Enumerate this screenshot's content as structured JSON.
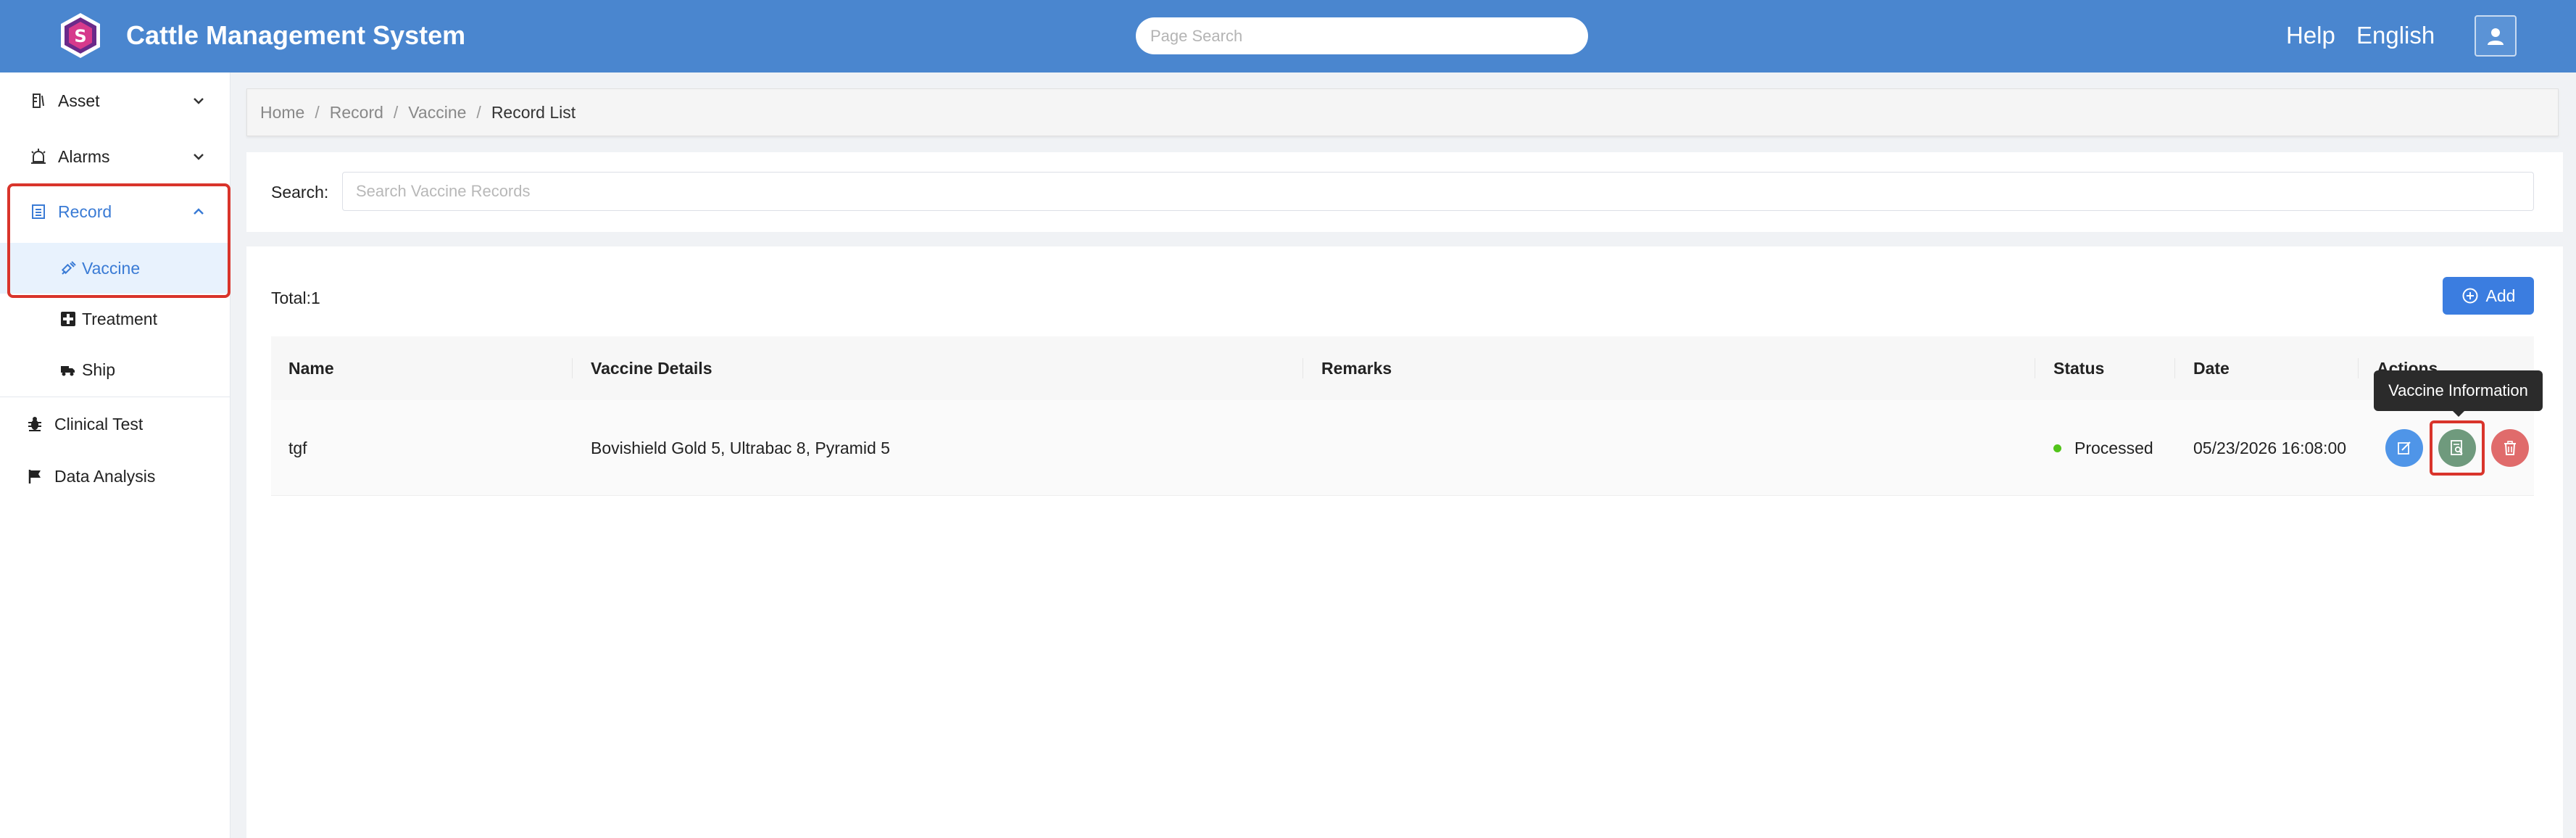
{
  "header": {
    "app_title": "Cattle Management System",
    "search_placeholder": "Page Search",
    "help_label": "Help",
    "language_label": "English",
    "brand_color": "#4a86cf"
  },
  "sidebar": {
    "items": [
      {
        "label": "Asset",
        "icon": "ruler-icon",
        "expanded": false
      },
      {
        "label": "Alarms",
        "icon": "alarm-icon",
        "expanded": false
      },
      {
        "label": "Record",
        "icon": "list-icon",
        "expanded": true,
        "children": [
          {
            "label": "Vaccine",
            "icon": "syringe-icon",
            "active": true
          },
          {
            "label": "Treatment",
            "icon": "medical-cross-icon"
          },
          {
            "label": "Ship",
            "icon": "truck-icon"
          }
        ]
      },
      {
        "label": "Clinical Test",
        "icon": "bug-icon"
      },
      {
        "label": "Data Analysis",
        "icon": "flag-icon"
      }
    ]
  },
  "breadcrumb": [
    "Home",
    "Record",
    "Vaccine",
    "Record List"
  ],
  "search": {
    "label": "Search:",
    "placeholder": "Search Vaccine Records"
  },
  "records": {
    "total_label": "Total:1",
    "add_label": "Add",
    "columns": [
      "Name",
      "Vaccine Details",
      "Remarks",
      "Status",
      "Date",
      "Actions"
    ],
    "rows": [
      {
        "name": "tgf",
        "vaccine_details": "Bovishield Gold 5, Ultrabac 8, Pyramid 5",
        "remarks": "",
        "status": "Processed",
        "date": "05/23/2026 16:08:00"
      }
    ],
    "tooltip": "Vaccine Information",
    "status_color": "#52c41a"
  }
}
